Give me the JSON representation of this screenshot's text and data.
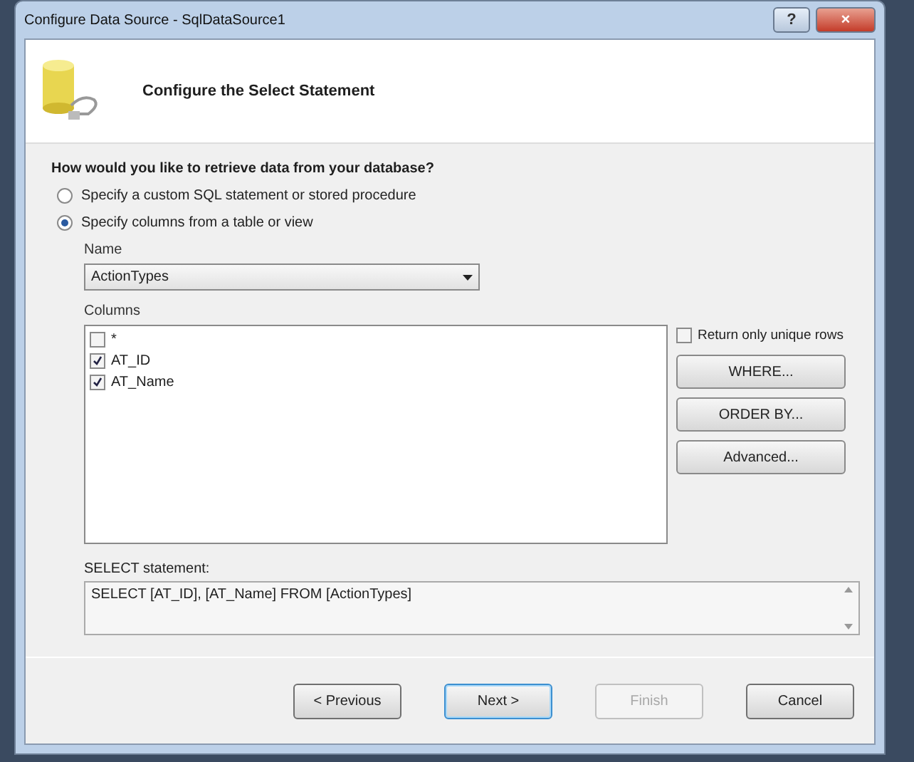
{
  "window": {
    "title": "Configure Data Source - SqlDataSource1",
    "buttons": [
      {
        "kind": "help",
        "label": "?"
      },
      {
        "kind": "close",
        "label": "×"
      }
    ]
  },
  "header": {
    "title": "Configure the Select Statement"
  },
  "question": "How would you like to retrieve data from your database?",
  "options": [
    {
      "label": "Specify a custom SQL statement or stored procedure",
      "selected": false
    },
    {
      "label": "Specify columns from a table or view",
      "selected": true
    }
  ],
  "name_field": {
    "label": "Name",
    "value": "ActionTypes"
  },
  "columns": {
    "label": "Columns",
    "items": [
      {
        "label": "*",
        "checked": false
      },
      {
        "label": "AT_ID",
        "checked": true
      },
      {
        "label": "AT_Name",
        "checked": true
      }
    ]
  },
  "unique_rows": {
    "label": "Return only unique rows",
    "checked": false
  },
  "side_buttons": [
    "WHERE...",
    "ORDER BY...",
    "Advanced..."
  ],
  "select_statement": {
    "label": "SELECT statement:",
    "value": "SELECT [AT_ID], [AT_Name] FROM [ActionTypes]"
  },
  "footer_buttons": [
    {
      "label": "< Previous",
      "disabled": false,
      "default": false
    },
    {
      "label": "Next >",
      "disabled": false,
      "default": true
    },
    {
      "label": "Finish",
      "disabled": true,
      "default": false
    },
    {
      "label": "Cancel",
      "disabled": false,
      "default": false
    }
  ]
}
